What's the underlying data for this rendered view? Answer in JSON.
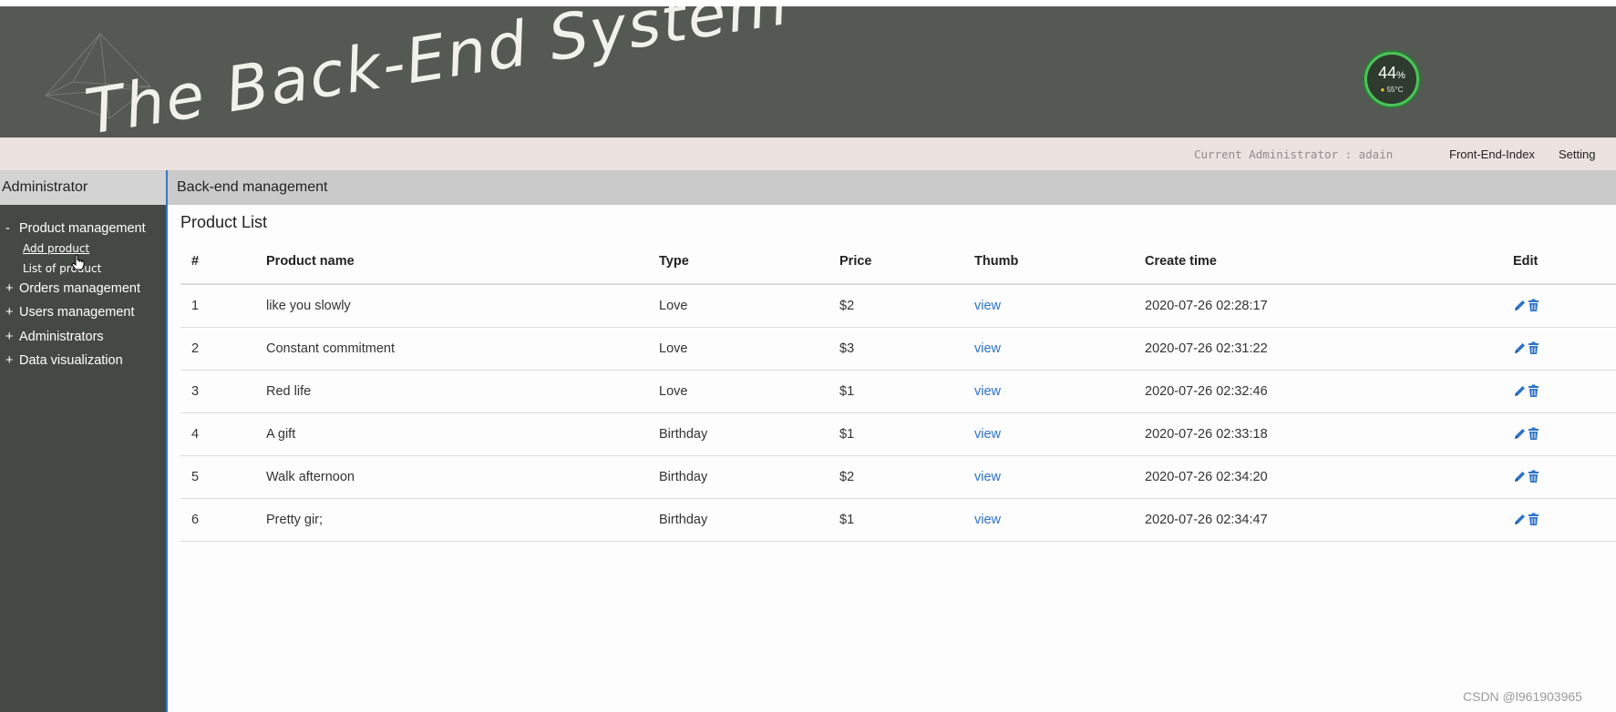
{
  "header": {
    "title": "The Back-End System",
    "gauge": {
      "percent": "44",
      "percent_sign": "%",
      "temperature": "55°C"
    }
  },
  "infobar": {
    "admin_text": "Current Administrator : adain",
    "links": [
      "Front-End-Index",
      "Setting"
    ]
  },
  "sidebar": {
    "heading": "Administrator",
    "items": [
      {
        "sign": "-",
        "label": "Product management",
        "children": [
          "Add product",
          "List of product"
        ]
      },
      {
        "sign": "+",
        "label": "Orders management"
      },
      {
        "sign": "+",
        "label": "Users management"
      },
      {
        "sign": "+",
        "label": "Administrators"
      },
      {
        "sign": "+",
        "label": "Data visualization"
      }
    ]
  },
  "main": {
    "heading": "Back-end management",
    "list_title": "Product List",
    "columns": [
      "#",
      "Product name",
      "Type",
      "Price",
      "Thumb",
      "Create time",
      "Edit"
    ],
    "rows": [
      {
        "id": "1",
        "name": "like you slowly",
        "type": "Love",
        "price": "$2",
        "thumb": "view",
        "created": "2020-07-26 02:28:17"
      },
      {
        "id": "2",
        "name": "Constant commitment",
        "type": "Love",
        "price": "$3",
        "thumb": "view",
        "created": "2020-07-26 02:31:22"
      },
      {
        "id": "3",
        "name": "Red life",
        "type": "Love",
        "price": "$1",
        "thumb": "view",
        "created": "2020-07-26 02:32:46"
      },
      {
        "id": "4",
        "name": "A gift",
        "type": "Birthday",
        "price": "$1",
        "thumb": "view",
        "created": "2020-07-26 02:33:18"
      },
      {
        "id": "5",
        "name": "Walk afternoon",
        "type": "Birthday",
        "price": "$2",
        "thumb": "view",
        "created": "2020-07-26 02:34:20"
      },
      {
        "id": "6",
        "name": "Pretty gir;",
        "type": "Birthday",
        "price": "$1",
        "thumb": "view",
        "created": "2020-07-26 02:34:47"
      }
    ]
  },
  "watermark": "CSDN @l961903965",
  "colors": {
    "banner": "#545953",
    "link": "#2c72c7",
    "sidebar": "#454944",
    "accent_border": "#3a78c9"
  }
}
